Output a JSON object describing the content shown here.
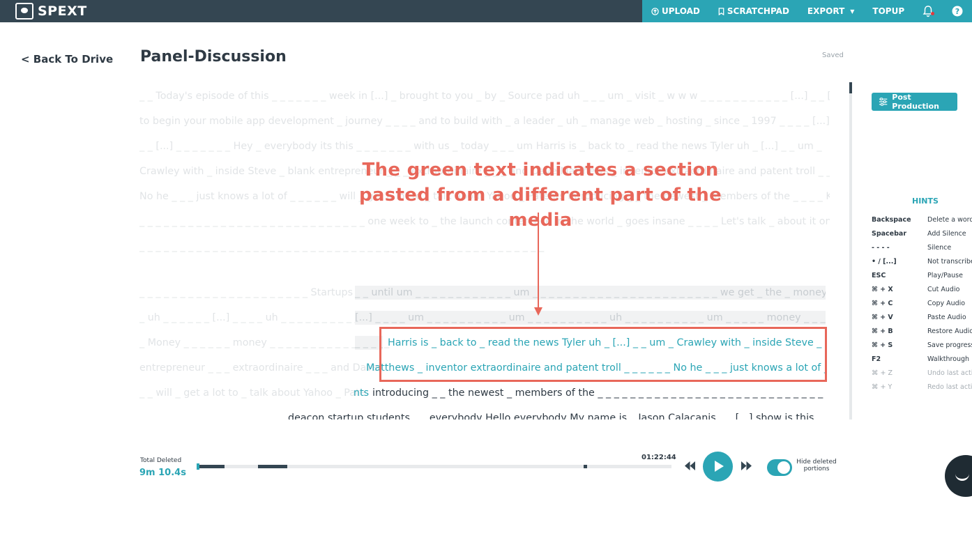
{
  "app": {
    "logo": "SPEXT"
  },
  "nav": {
    "upload": "UPLOAD",
    "scratchpad": "SCRATCHPAD",
    "export": "EXPORT",
    "topup": "TOPUP",
    "help": "?"
  },
  "page": {
    "back": "< Back To Drive",
    "title": "Panel-Discussion",
    "status": "Saved"
  },
  "transcript": {
    "lines": [
      "_ _ Today's episode of this _ _ _ _ _ _ _ week in [...] _ brought to you _ by _ Source pad uh _ _ _ um _ visit _ w w w _ _ _ _ _ _ _ _ _ _ _ [...] _ _ [...] _ _ _ _ _",
      "to begin your mobile app development _ journey _ _ _ _ and to build with _ a leader _ uh _ manage web _ hosting _ since _ 1997 _ _ _ _ [...] _ _ _ _ [...] _ _",
      "_ _ [...] _ _ _ _ _ _ _ Hey _ everybody its this _ _ _ _ _ _ _ with us _ today _ _ _ um Harris is _ back to _ read the news Tyler uh _ [...] _ _ um _",
      "Crawley with _ inside Steve _ blank entrepreneur _ _ _ extraordinaire _ _ _ and Dave Matthews _ inventor extraordinaire and patent troll _ _ _ _ _ _",
      "No he _ _ _ just knows a lot of _ _ _ _ _ _ will _ get a lot to _ talk about Yahoo _ Patents introducing _ _ the newest _ members of the _ _ _ _ Kevin _ Rose _ to _ _ _",
      "_ _ _ _ _ _ _ _ _ _ _ _ _ _ _ _ _ _ _ _ _ _ _ _ _ _ _ _ one week to _ the launch conference in the world _ goes insane _ _ _ _ Let's talk _ about it on this _ _ _",
      "_ _ _ _ _ _ _ _ _ _ _ _ _ _ _ _ _ _ _ _ _ _ _ _ _ _ _ _ _ _ _ _ _ _ _ _ _ _ _ _ _ _ _ _ _ _ _ _ _ _"
    ],
    "block_faded": [
      "_ _ _ _ _ _ _ _ _ _ _ _ _ _ _ _ _ _ _ _ _ Startups _ _",
      "_ uh _ _ _ _ _ _ [...] _ _ _ _ uh _ _ _ _ _ _ _ _ _ _ _",
      "_ Money _ _ _ _ _ _ money _ _ _ _ _ _ _ _ _ _ _ _ _ _ _"
    ],
    "block_grey": [
      "_ _ until um _ _ _ _ _ _ _ _ _ _ _ _ um _ _ _ _ _ _ _ _ _ _ _ _ _ _ _ _ _ _ _ _ _ _ _ we get _ the _ money _ _ _",
      "[...] _ _ _ _ um _ _ _ _ _ _ _ _ _ _ um _ _ _ _ _ _ _ _ _ _ uh _ _ _ _ _ _ _ _ _ _ um _ _ _ _ _ money _ _ _",
      "_ _ _ _"
    ],
    "green_1": "Harris is _ back to _ read the news Tyler uh _ [...] _ _ um _ Crawley with _ inside Steve _ blank",
    "faded_2": "entrepreneur _ _ _ extraordinaire _ _ _ and Dave",
    "green_2": "Matthews _ inventor extraordinaire and patent troll _ _ _ _ _ _ No he _ _ _ just knows a lot of _ _ _ _",
    "faded_3": "_ _ will _ get a lot to _ talk about Yahoo _ Pate",
    "green_3": "nts",
    "dark_3": "introducing _ _ the newest _ members of the _ _ _ _ _ _ _ _ _ _ _ _ _ _ _ _ _ _ _ _ _ _ _ _ _ _ _ _ _",
    "dark_4": "deacon startup students _ _ everybody Hello everybody My name is _ Jason Calacanis _ _ [...] show is this"
  },
  "annotation": {
    "line1": "The green  text indicates a section",
    "line2": "pasted from a different part  of the media"
  },
  "sidebar": {
    "post_production": "Post Production",
    "hints_title": "HINTS",
    "hints": [
      {
        "key": "Backspace",
        "desc": "Delete a word"
      },
      {
        "key": "Spacebar",
        "desc": "Add Silence"
      },
      {
        "key": "- - - -",
        "desc": "Silence"
      },
      {
        "key": "• / [...]",
        "desc": "Not transcribed"
      },
      {
        "key": "ESC",
        "desc": "Play/Pause"
      },
      {
        "key": "⌘ + X",
        "desc": "Cut Audio"
      },
      {
        "key": "⌘ + C",
        "desc": "Copy Audio"
      },
      {
        "key": "⌘ + V",
        "desc": "Paste Audio"
      },
      {
        "key": "⌘ + B",
        "desc": "Restore Audio"
      },
      {
        "key": "⌘ + S",
        "desc": "Save progress"
      },
      {
        "key": "F2",
        "desc": "Walkthrough"
      },
      {
        "key": "⌘ + Z",
        "desc": "Undo last action"
      },
      {
        "key": "⌘ + Y",
        "desc": "Redo last action"
      }
    ]
  },
  "player": {
    "total_deleted_label": "Total Deleted",
    "total_deleted_value": "9m 10.4s",
    "duration": "01:22:44",
    "toggle_label": "Hide deleted portions",
    "hide_deleted": true
  },
  "colors": {
    "accent": "#2ba5b5",
    "topbar": "#344652",
    "annotation": "#e8675a"
  }
}
